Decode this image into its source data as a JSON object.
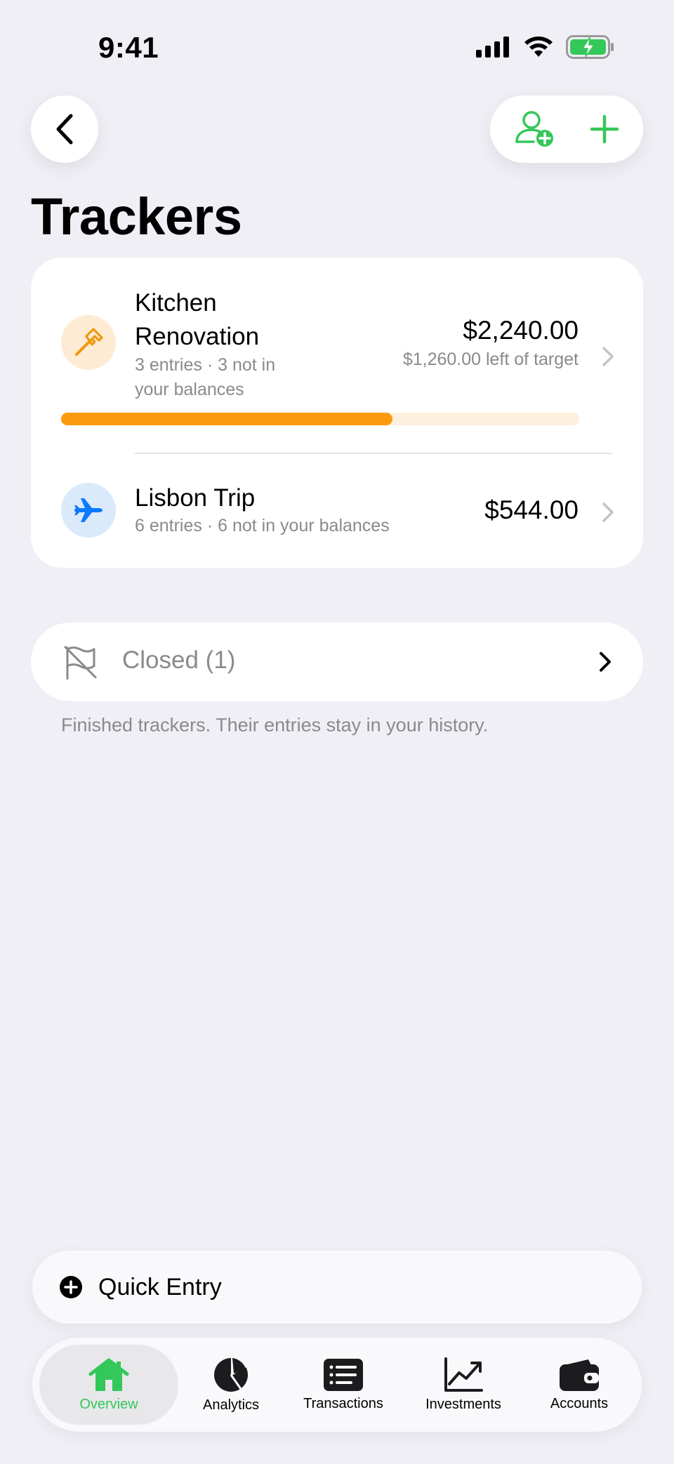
{
  "status_bar": {
    "time": "9:41"
  },
  "header": {
    "title": "Trackers"
  },
  "colors": {
    "accent": "#34c759",
    "orange": "#fb9a0d",
    "blue": "#0a7aff"
  },
  "trackers": [
    {
      "name": "Kitchen Renovation",
      "name_line1": "Kitchen",
      "name_line2": "Renovation",
      "sub_line1": "3 entries · 3 not in",
      "sub_line2": "your balances",
      "amount": "$2,240.00",
      "target_note": "$1,260.00 left of target",
      "icon": "hammer-icon",
      "progress": 0.64
    },
    {
      "name": "Lisbon Trip",
      "sub": "6 entries · 6 not in your balances",
      "amount": "$544.00",
      "icon": "airplane-icon"
    }
  ],
  "closed": {
    "label": "Closed (1)",
    "footnote": "Finished trackers. Their entries stay in your history."
  },
  "quick_entry": {
    "label": "Quick Entry"
  },
  "tabs": [
    {
      "label": "Overview",
      "icon": "house-icon",
      "active": true
    },
    {
      "label": "Analytics",
      "icon": "pie-chart-icon",
      "active": false
    },
    {
      "label": "Transactions",
      "icon": "list-icon",
      "active": false
    },
    {
      "label": "Investments",
      "icon": "trend-chart-icon",
      "active": false
    },
    {
      "label": "Accounts",
      "icon": "wallet-icon",
      "active": false
    }
  ]
}
